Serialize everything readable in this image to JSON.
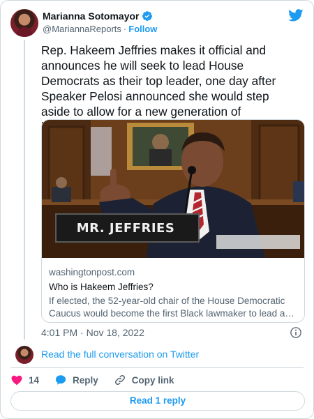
{
  "author": {
    "name": "Marianna Sotomayor",
    "handle": "@MariannaReports",
    "separator": "·",
    "follow_label": "Follow"
  },
  "tweet": {
    "text": "Rep. Hakeem Jeffries makes it official and announces he will seek to lead House Democrats as their top leader, one day after Speaker Pelosi announced she would step aside to allow for a new generation of leadership:"
  },
  "link_card": {
    "image_nameplate": "MR. JEFFRIES",
    "domain": "washingtonpost.com",
    "title": "Who is Hakeem Jeffries?",
    "description": "If elected, the 52-year-old chair of the House Democratic Caucus would become the first Black lawmaker to lead a party in Congress."
  },
  "meta": {
    "timestamp": "4:01 PM · Nov 18, 2022"
  },
  "conversation": {
    "label": "Read the full conversation on Twitter"
  },
  "actions": {
    "like_count": "14",
    "reply_label": "Reply",
    "copy_link_label": "Copy link"
  },
  "read_replies": {
    "label": "Read 1 reply"
  },
  "colors": {
    "accent": "#1d9bf0",
    "like": "#f91880",
    "muted": "#536471",
    "border": "#cfd9de"
  },
  "icons": [
    "verified-badge-icon",
    "twitter-bird-icon",
    "info-icon",
    "heart-icon",
    "reply-bubble-icon",
    "link-icon"
  ]
}
